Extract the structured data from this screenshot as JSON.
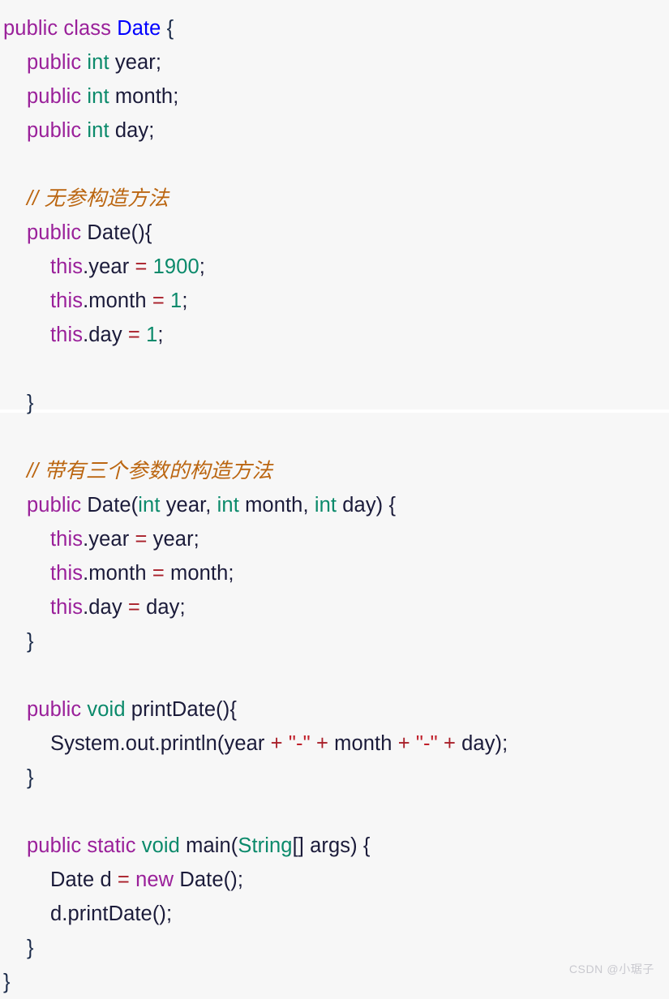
{
  "background_color": "#f7f7f7",
  "colors": {
    "keyword": "#9a209a",
    "type": "#0b8a6b",
    "class_name": "#0000ff",
    "number": "#0b8a6b",
    "operator": "#a81e28",
    "string": "#c01f2a",
    "comment": "#bb6611",
    "plain_text": "#1b1b3a",
    "watermark": "#c9c9cf"
  },
  "language": "Java",
  "code": {
    "line_01": {
      "kw1": "public class",
      "cls": "Date",
      "tail": " {"
    },
    "line_02": {
      "kw": "public",
      "type": "int",
      "name": "year;"
    },
    "line_03": {
      "kw": "public",
      "type": "int",
      "name": "month;"
    },
    "line_04": {
      "kw": "public",
      "type": "int",
      "name": "day;"
    },
    "line_05": {
      "blank": " "
    },
    "line_06": {
      "comment": "// 无参构造方法"
    },
    "line_07": {
      "kw": "public",
      "sig": "Date(){"
    },
    "line_08": {
      "kw": "this",
      "field": ".year ",
      "op": "=",
      "num": " 1900",
      "end": ";"
    },
    "line_09": {
      "kw": "this",
      "field": ".month ",
      "op": "=",
      "num": " 1",
      "end": ";"
    },
    "line_10": {
      "kw": "this",
      "field": ".day ",
      "op": "=",
      "num": " 1",
      "end": ";"
    },
    "line_11": {
      "blank": " "
    },
    "line_12": {
      "brace": "}"
    },
    "line_13": {
      "blank": " "
    },
    "line_14": {
      "comment": "// 带有三个参数的构造方法"
    },
    "line_15": {
      "kw": "public",
      "name": "Date(",
      "t1": "int",
      "p1": " year, ",
      "t2": "int",
      "p2": " month, ",
      "t3": "int",
      "p3": " day) {"
    },
    "line_16": {
      "kw": "this",
      "field": ".year ",
      "op": "=",
      "val": " year;"
    },
    "line_17": {
      "kw": "this",
      "field": ".month ",
      "op": "=",
      "val": " month;"
    },
    "line_18": {
      "kw": "this",
      "field": ".day ",
      "op": "=",
      "val": " day;"
    },
    "line_19": {
      "brace": "}"
    },
    "line_20": {
      "blank": " "
    },
    "line_21": {
      "kw": "public",
      "type": "void",
      "sig": "printDate(){"
    },
    "line_22": {
      "head": "System.out.println(year ",
      "op1": "+",
      "s1": " \"-\" ",
      "op2": "+",
      "mid": " month ",
      "op3": "+",
      "s2": " \"-\" ",
      "op4": "+",
      "tail": " day);"
    },
    "line_23": {
      "brace": "}"
    },
    "line_24": {
      "blank": " "
    },
    "line_25": {
      "kw1": "public",
      "kw2": "static",
      "type": "void",
      "name": "main(",
      "strtype": "String",
      "tail": "[] args) {"
    },
    "line_26": {
      "decl": "Date d ",
      "op": "=",
      "kw": " new",
      "tail": " Date();"
    },
    "line_27": {
      "call": "d.printDate();"
    },
    "line_28": {
      "brace": "}"
    },
    "line_29": {
      "brace": "}"
    }
  },
  "watermark": {
    "text": "CSDN @小琚子"
  }
}
